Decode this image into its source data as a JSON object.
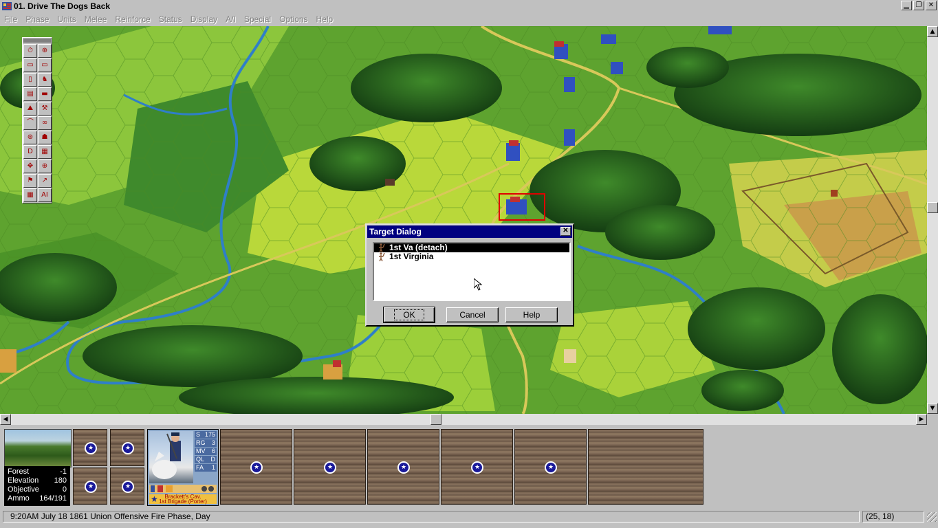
{
  "window": {
    "title": "01. Drive The Dogs Back",
    "btn_min": "▁",
    "btn_restore": "❐",
    "btn_close": "✕"
  },
  "menu": {
    "items": [
      "File",
      "Phase",
      "Units",
      "Melee",
      "Reinforce",
      "Status",
      "Display",
      "A/I",
      "Special",
      "Options",
      "Help"
    ]
  },
  "toolbar": {
    "buttons": [
      "⏱",
      "⊕",
      "▭",
      "▭",
      "▯",
      "♞",
      "▤",
      "▬",
      "⛰",
      "⚒",
      "⌒",
      "∞",
      "⊛",
      "☗",
      "D",
      "▦",
      "✥",
      "⊕",
      "⚑",
      "↗",
      "▦",
      "AI"
    ]
  },
  "dialog": {
    "title": "Target Dialog",
    "close": "✕",
    "items": [
      {
        "label": "1st Va (detach)",
        "selected": true
      },
      {
        "label": "1st Virginia",
        "selected": false
      }
    ],
    "ok": "OK",
    "cancel": "Cancel",
    "help": "Help"
  },
  "terrain": {
    "rows": [
      {
        "label": "Forest",
        "value": "-1"
      },
      {
        "label": "Elevation",
        "value": "180"
      },
      {
        "label": "Objective",
        "value": "0"
      },
      {
        "label": "Ammo",
        "value": "164/191"
      }
    ]
  },
  "unit": {
    "stats": [
      {
        "k": "S",
        "v": "175"
      },
      {
        "k": "RG",
        "v": "3"
      },
      {
        "k": "MV",
        "v": "6"
      },
      {
        "k": "QL",
        "v": "D"
      },
      {
        "k": "FA",
        "v": "1"
      }
    ],
    "name": "Brackett's Cav.",
    "command": "1st Brigade (Porter)"
  },
  "status": {
    "text": "9:20AM July 18 1861 Union Offensive Fire Phase, Day",
    "coords": "(25, 18)"
  },
  "colors": {
    "dialog_title": "#000080",
    "selection_box": "#e00000",
    "union_badge": "#1a1a9a"
  }
}
